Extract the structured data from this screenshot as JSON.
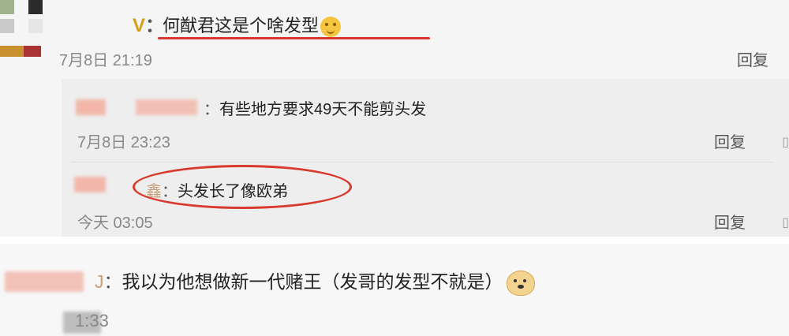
{
  "comment": {
    "text": "何猷君这是个啥发型",
    "time": "7月8日 21:19",
    "reply_label": "回复",
    "badge": "V",
    "colon": "："
  },
  "replies": [
    {
      "text": "有些地方要求49天不能剪头发",
      "time": "7月8日 23:23",
      "reply_label": "回复",
      "colon": "："
    },
    {
      "text": "头发长了像欧弟",
      "time": "今天 03:05",
      "reply_label": "回复",
      "colon": "：",
      "name_tail": "鑫"
    }
  ],
  "second_comment": {
    "text": "我以为他想做新一代赌王（发哥的发型不就是）",
    "time": "1:33",
    "name_tail": "J",
    "colon": "："
  },
  "icons": [
    "shush-emoji-icon",
    "doge-emoji-icon",
    "thumb-up-icon"
  ],
  "colors": {
    "annotation": "#d83a2e",
    "badge": "#d4a017"
  }
}
